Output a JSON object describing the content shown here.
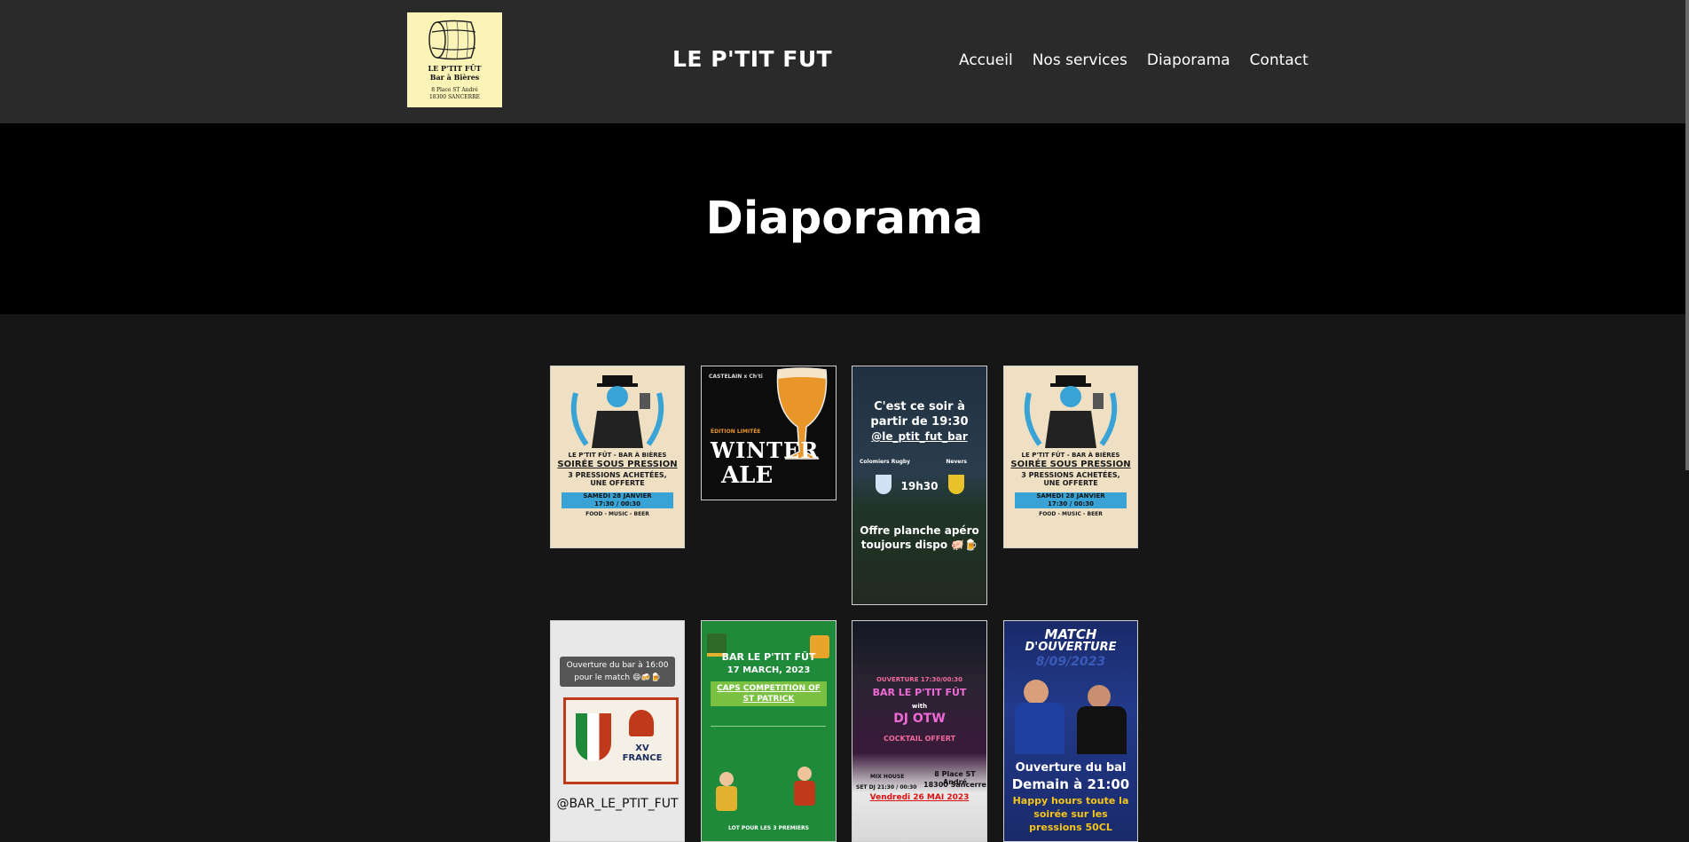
{
  "header": {
    "logo": {
      "name": "LE P'TIT FÛT",
      "tagline": "Bar à Bières",
      "address_line1": "8 Place ST André",
      "address_line2": "18300 SANCERRE"
    },
    "site_title": "LE P'TIT FUT",
    "nav": [
      "Accueil",
      "Nos services",
      "Diaporama",
      "Contact"
    ]
  },
  "hero": {
    "title": "Diaporama"
  },
  "gallery": {
    "pressure": {
      "brand": "LE P'TIT FÛT - BAR À BIÈRES",
      "headline": "SOIRÉE SOUS PRESSION",
      "offer": "3 PRESSIONS ACHETÉES, UNE OFFERTE",
      "date": "SAMEDI 28 JANVIER",
      "time": "17:30 / 00:30",
      "tags": "FOOD - MUSIC - BEER"
    },
    "winter": {
      "brand": "CASTELAIN x Ch'ti",
      "edition": "ÉDITION LIMITÉE",
      "name_line1": "WINTER",
      "name_line2": "ALE"
    },
    "rugby": {
      "line1": "C'est ce soir à",
      "line2": "partir de 19:30",
      "handle": "@le_ptit_fut_bar",
      "team_home": "Colomiers Rugby",
      "team_away": "Nevers",
      "kickoff": "19h30",
      "offer_line1": "Offre planche apéro",
      "offer_line2": "toujours dispo 🐖🍺"
    },
    "match": {
      "caption": "Ouverture du bar à 16:00 pour le match 😄🍻🍺",
      "handle": "@BAR_LE_PTIT_FUT",
      "team": "XV FRANCE"
    },
    "patrick": {
      "line1": "BAR LE P'TIT FÛT",
      "line2": "17 MARCH, 2023",
      "title": "CAPS COMPETITION OF ST PATRICK",
      "footer": "LOT POUR LES 3 PREMIERS"
    },
    "dj": {
      "opening": "OUVERTURE 17:30/00:30",
      "venue": "BAR LE P'TIT FÛT",
      "with": "with",
      "dj": "DJ OTW",
      "cocktail": "COCKTAIL OFFERT",
      "address1": "8 Place ST André",
      "address2": "18300 Sancerre",
      "mix": "MIX HOUSE",
      "set": "SET DJ 21:30 / 00:30",
      "date": "Vendredi 26 MAI 2023"
    },
    "rwc": {
      "title1": "MATCH",
      "title2": "D'OUVERTURE",
      "date": "8/09/2023",
      "line1": "Ouverture du bal",
      "line2": "Demain à 21:00",
      "line3": "Happy hours toute la",
      "line4": "soirée sur les",
      "line5": "pressions 50CL"
    }
  }
}
